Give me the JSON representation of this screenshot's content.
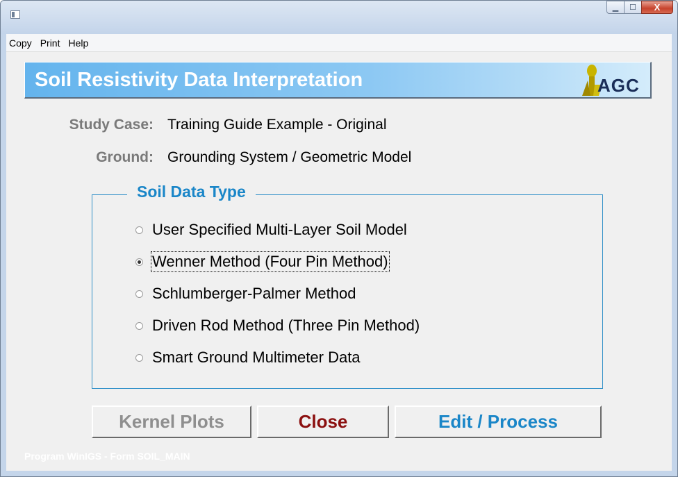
{
  "window": {
    "controls": {
      "minimize": "▁",
      "maximize": "☐",
      "close": "X"
    }
  },
  "menu": {
    "items": [
      "Copy",
      "Print",
      "Help"
    ]
  },
  "banner": {
    "title": "Soil Resistivity Data Interpretation",
    "logo_text": "AGC"
  },
  "study_case": {
    "label": "Study Case:",
    "value": "Training Guide Example - Original"
  },
  "ground": {
    "label": "Ground:",
    "value": "Grounding System / Geometric Model"
  },
  "soil_data_type": {
    "title": "Soil Data Type",
    "options": [
      {
        "label": "User Specified Multi-Layer Soil Model",
        "checked": false
      },
      {
        "label": "Wenner Method (Four Pin Method)",
        "checked": true
      },
      {
        "label": "Schlumberger-Palmer Method",
        "checked": false
      },
      {
        "label": "Driven Rod Method (Three Pin Method)",
        "checked": false
      },
      {
        "label": "Smart Ground Multimeter Data",
        "checked": false
      }
    ]
  },
  "buttons": {
    "kernel": "Kernel Plots",
    "close": "Close",
    "edit": "Edit / Process"
  },
  "footer": {
    "text": "Program WinIGS - Form SOIL_MAIN"
  },
  "colors": {
    "banner": "#64b4ed",
    "accent": "#1a86c8",
    "close_text": "#8b0f0f",
    "disabled": "#8f8f8f"
  }
}
